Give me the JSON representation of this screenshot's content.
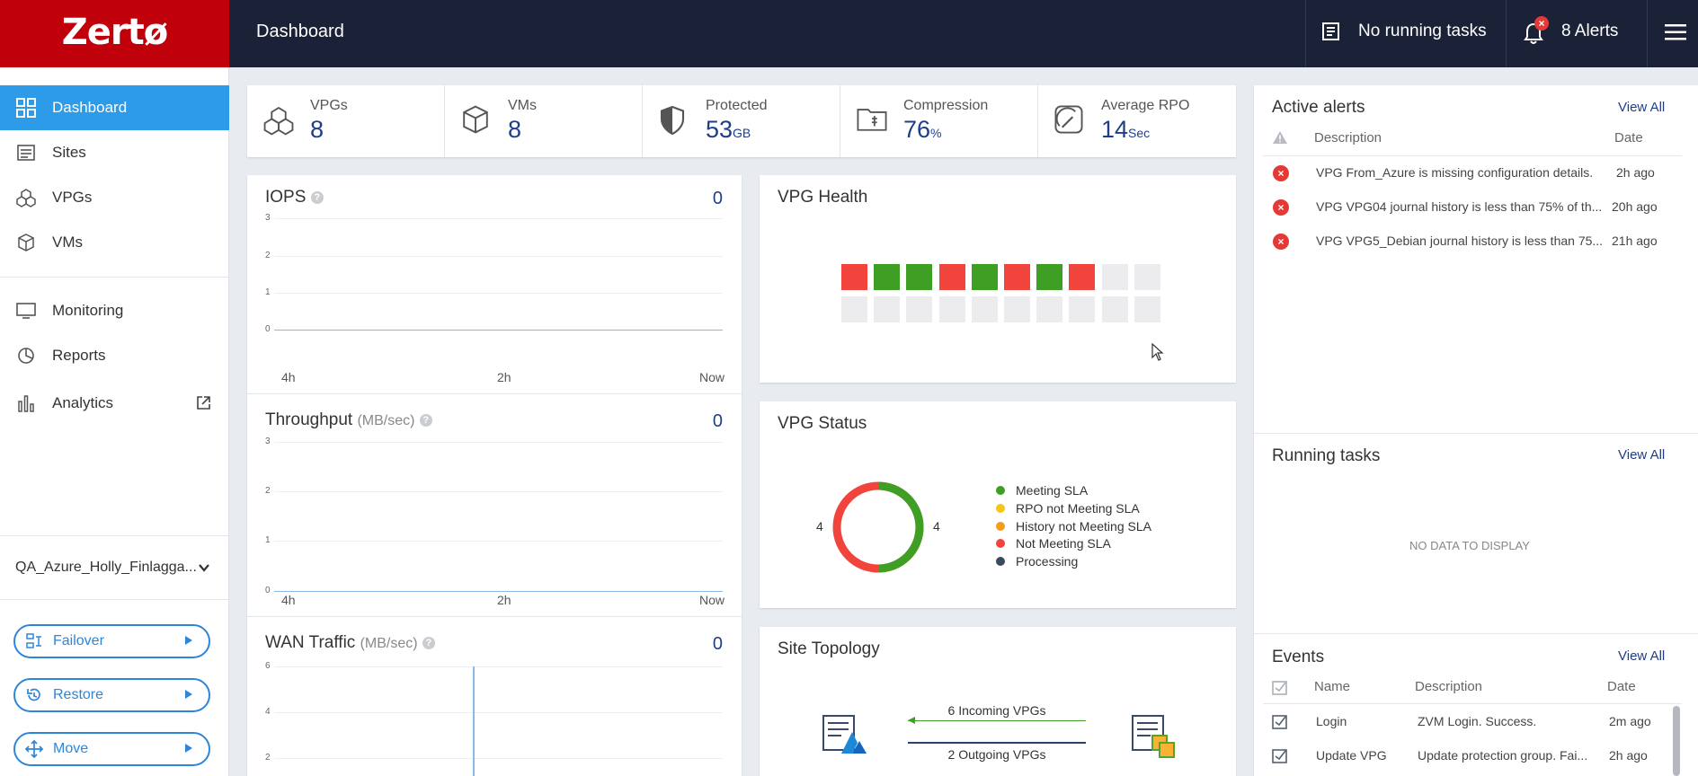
{
  "app": {
    "logo": "Zertø",
    "page_title": "Dashboard"
  },
  "topbar": {
    "tasks": "No running tasks",
    "alerts": "8 Alerts",
    "alert_badge": "×"
  },
  "sidebar": {
    "items": [
      {
        "label": "Dashboard",
        "icon": "dashboard-grid-icon"
      },
      {
        "label": "Sites",
        "icon": "sites-icon"
      },
      {
        "label": "VPGs",
        "icon": "vpgs-cubes-icon"
      },
      {
        "label": "VMs",
        "icon": "vm-cube-icon"
      },
      {
        "label": "Monitoring",
        "icon": "monitor-icon"
      },
      {
        "label": "Reports",
        "icon": "pie-report-icon"
      },
      {
        "label": "Analytics",
        "icon": "bar-chart-icon"
      }
    ],
    "site_selector": "QA_Azure_Holly_Finlagga...",
    "actions": {
      "failover": "Failover",
      "restore": "Restore",
      "move": "Move"
    }
  },
  "stats": [
    {
      "label": "VPGs",
      "value": "8",
      "unit": ""
    },
    {
      "label": "VMs",
      "value": "8",
      "unit": ""
    },
    {
      "label": "Protected",
      "value": "53",
      "unit": "GB"
    },
    {
      "label": "Compression",
      "value": "76",
      "unit": "%"
    },
    {
      "label": "Average RPO",
      "value": "14",
      "unit": "Sec"
    }
  ],
  "iops": {
    "title": "IOPS",
    "value": "0",
    "y_ticks": [
      "3",
      "2",
      "1",
      "0"
    ],
    "x_ticks": [
      "4h",
      "2h",
      "Now"
    ]
  },
  "throughput": {
    "title": "Throughput",
    "unit": "(MB/sec)",
    "value": "0",
    "y_ticks": [
      "3",
      "2",
      "1",
      "0"
    ],
    "x_ticks": [
      "4h",
      "2h",
      "Now"
    ]
  },
  "wan": {
    "title": "WAN Traffic",
    "unit": "(MB/sec)",
    "value": "0",
    "y_ticks": [
      "6",
      "4",
      "2"
    ]
  },
  "vpg_health": {
    "title": "VPG Health",
    "row1": [
      "red",
      "green",
      "green",
      "red",
      "green",
      "red",
      "green",
      "red",
      "empty",
      "empty"
    ],
    "colors": {
      "red": "#f0443c",
      "green": "#3f9e24",
      "empty": "#ececee"
    }
  },
  "vpg_status": {
    "title": "VPG Status",
    "left_count": "4",
    "right_count": "4",
    "legend": [
      {
        "label": "Meeting SLA",
        "color": "#3f9e24"
      },
      {
        "label": "RPO not Meeting SLA",
        "color": "#f5c518"
      },
      {
        "label": "History not Meeting SLA",
        "color": "#f59c1a"
      },
      {
        "label": "Not Meeting SLA",
        "color": "#f0443c"
      },
      {
        "label": "Processing",
        "color": "#3a4a5c"
      }
    ],
    "chart_data": {
      "type": "pie",
      "categories": [
        "Meeting SLA",
        "RPO not Meeting SLA",
        "History not Meeting SLA",
        "Not Meeting SLA",
        "Processing"
      ],
      "values": [
        4,
        0,
        0,
        4,
        0
      ]
    }
  },
  "site_topology": {
    "title": "Site Topology",
    "incoming": "6 Incoming VPGs",
    "outgoing": "2 Outgoing VPGs"
  },
  "active_alerts": {
    "title": "Active alerts",
    "view_all": "View All",
    "headers": {
      "description": "Description",
      "date": "Date"
    },
    "rows": [
      {
        "description": "VPG From_Azure is missing configuration details.",
        "date": "2h ago"
      },
      {
        "description": "VPG VPG04 journal history is less than 75% of th...",
        "date": "20h ago"
      },
      {
        "description": "VPG VPG5_Debian journal history is less than 75...",
        "date": "21h ago"
      }
    ]
  },
  "running_tasks": {
    "title": "Running tasks",
    "view_all": "View All",
    "empty": "NO DATA TO DISPLAY"
  },
  "events": {
    "title": "Events",
    "view_all": "View All",
    "headers": {
      "name": "Name",
      "description": "Description",
      "date": "Date"
    },
    "rows": [
      {
        "name": "Login",
        "description": "ZVM Login. Success.",
        "date": "2m ago"
      },
      {
        "name": "Update VPG",
        "description": "Update protection group. Fai...",
        "date": "2h ago"
      }
    ]
  }
}
